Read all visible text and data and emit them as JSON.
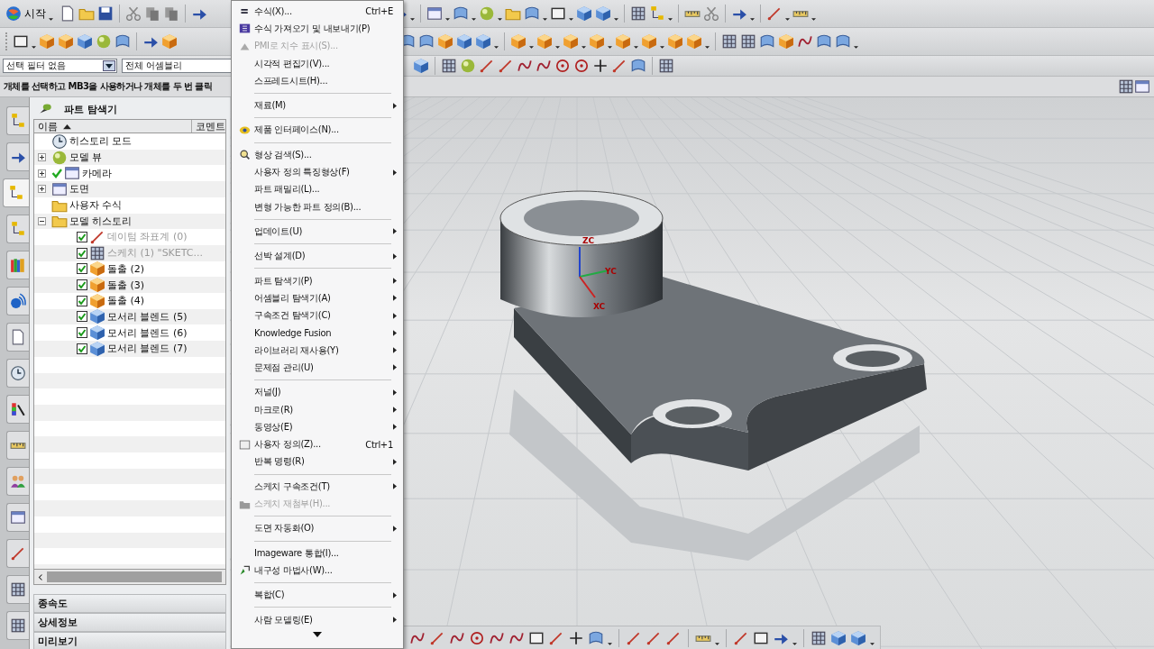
{
  "toolbar": {
    "start_button": "시작"
  },
  "filters": [
    {
      "value": "선택 필터 없음"
    },
    {
      "value": "전체 어셈블리"
    }
  ],
  "cue_line": "개체를 선택하고 MB3을 사용하거나 개체를 두 번 클릭",
  "resource_tabs": [
    {
      "selected": false
    },
    {
      "selected": false
    },
    {
      "selected": true
    },
    {
      "selected": false
    },
    {
      "selected": false
    },
    {
      "selected": false
    },
    {
      "selected": false
    },
    {
      "selected": false
    },
    {
      "selected": false
    },
    {
      "selected": false
    },
    {
      "selected": false
    },
    {
      "selected": false
    },
    {
      "selected": false
    },
    {
      "selected": false
    },
    {
      "selected": false
    }
  ],
  "part_navigator": {
    "title": "파트 탐색기",
    "columns": [
      "이름",
      "코멘트"
    ],
    "tree": [
      {
        "label": "히스토리 모드",
        "kind": "history",
        "checked": false
      },
      {
        "label": "모델 뷰",
        "kind": "views",
        "expanded": false,
        "checked": false
      },
      {
        "label": "카메라",
        "kind": "camera",
        "expanded": false,
        "checked": true
      },
      {
        "label": "도면",
        "kind": "drawing",
        "expanded": false,
        "checked": false
      },
      {
        "label": "사용자 수식",
        "kind": "folder",
        "checked": false
      },
      {
        "label": "모델 히스토리",
        "kind": "folder",
        "expanded": true,
        "checked": false,
        "children": [
          {
            "label": "데이텀 좌표계 (0)",
            "kind": "datum",
            "checked": true,
            "dimmed": true
          },
          {
            "label": "스케치 (1) \"SKETC...",
            "kind": "sketch",
            "checked": true,
            "dimmed": true
          },
          {
            "label": "돌출 (2)",
            "kind": "extrude",
            "checked": true,
            "dimmed": false
          },
          {
            "label": "돌출 (3)",
            "kind": "extrude",
            "checked": true,
            "dimmed": false
          },
          {
            "label": "돌출 (4)",
            "kind": "extrude",
            "checked": true,
            "dimmed": false
          },
          {
            "label": "모서리 블렌드 (5)",
            "kind": "blend",
            "checked": true,
            "dimmed": false
          },
          {
            "label": "모서리 블렌드 (6)",
            "kind": "blend",
            "checked": true,
            "dimmed": false
          },
          {
            "label": "모서리 블렌드 (7)",
            "kind": "blend",
            "checked": true,
            "dimmed": false
          }
        ]
      }
    ]
  },
  "panels": [
    "종속도",
    "상세정보",
    "미리보기"
  ],
  "menu": {
    "groups": [
      [
        {
          "label": "수식(X)...",
          "shortcut": "Ctrl+E",
          "submenu": false,
          "disabled": false
        },
        {
          "label": "수식 가져오기 및 내보내기(P)",
          "submenu": false,
          "disabled": false
        },
        {
          "label": "PMI로 치수 표시(S)...",
          "submenu": false,
          "disabled": true
        },
        {
          "label": "시각적 편집기(V)...",
          "submenu": false,
          "disabled": false
        },
        {
          "label": "스프레드시트(H)...",
          "submenu": false,
          "disabled": false
        }
      ],
      [
        {
          "label": "재료(M)",
          "submenu": true,
          "disabled": false
        }
      ],
      [
        {
          "label": "제품 인터페이스(N)...",
          "submenu": false,
          "disabled": false
        }
      ],
      [
        {
          "label": "형상 검색(S)...",
          "submenu": false,
          "disabled": false
        },
        {
          "label": "사용자 정의 특징형상(F)",
          "submenu": true,
          "disabled": false
        },
        {
          "label": "파트 패밀리(L)...",
          "submenu": false,
          "disabled": false
        },
        {
          "label": "변형 가능한 파트 정의(B)...",
          "submenu": false,
          "disabled": false
        }
      ],
      [
        {
          "label": "업데이트(U)",
          "submenu": true,
          "disabled": false
        }
      ],
      [
        {
          "label": "선박 설계(D)",
          "submenu": true,
          "disabled": false
        }
      ],
      [
        {
          "label": "파트 탐색기(P)",
          "submenu": true,
          "disabled": false
        },
        {
          "label": "어셈블리 탐색기(A)",
          "submenu": true,
          "disabled": false
        },
        {
          "label": "구속조건 탐색기(C)",
          "submenu": true,
          "disabled": false
        },
        {
          "label": "Knowledge Fusion",
          "submenu": true,
          "disabled": false
        },
        {
          "label": "라이브러리 재사용(Y)",
          "submenu": true,
          "disabled": false
        },
        {
          "label": "문제점 관리(U)",
          "submenu": true,
          "disabled": false
        }
      ],
      [
        {
          "label": "저널(J)",
          "submenu": true,
          "disabled": false
        },
        {
          "label": "마크로(R)",
          "submenu": true,
          "disabled": false
        },
        {
          "label": "동영상(E)",
          "submenu": true,
          "disabled": false
        },
        {
          "label": "사용자 정의(Z)...",
          "shortcut": "Ctrl+1",
          "submenu": false,
          "disabled": false
        },
        {
          "label": "반복 명령(R)",
          "submenu": true,
          "disabled": false
        }
      ],
      [
        {
          "label": "스케치 구속조건(T)",
          "submenu": true,
          "disabled": false
        },
        {
          "label": "스케치 재첨부(H)...",
          "submenu": false,
          "disabled": true
        }
      ],
      [
        {
          "label": "도면 자동화(O)",
          "submenu": true,
          "disabled": false
        }
      ],
      [
        {
          "label": "Imageware 통합(I)...",
          "submenu": false,
          "disabled": false
        },
        {
          "label": "내구성 마법사(W)...",
          "submenu": false,
          "disabled": false
        }
      ],
      [
        {
          "label": "복합(C)",
          "submenu": true,
          "disabled": false
        }
      ],
      [
        {
          "label": "사람 모델링(E)",
          "submenu": true,
          "disabled": false
        }
      ]
    ]
  },
  "viewport": {
    "axis_labels": [
      "ZC",
      "YC",
      "XC"
    ]
  }
}
